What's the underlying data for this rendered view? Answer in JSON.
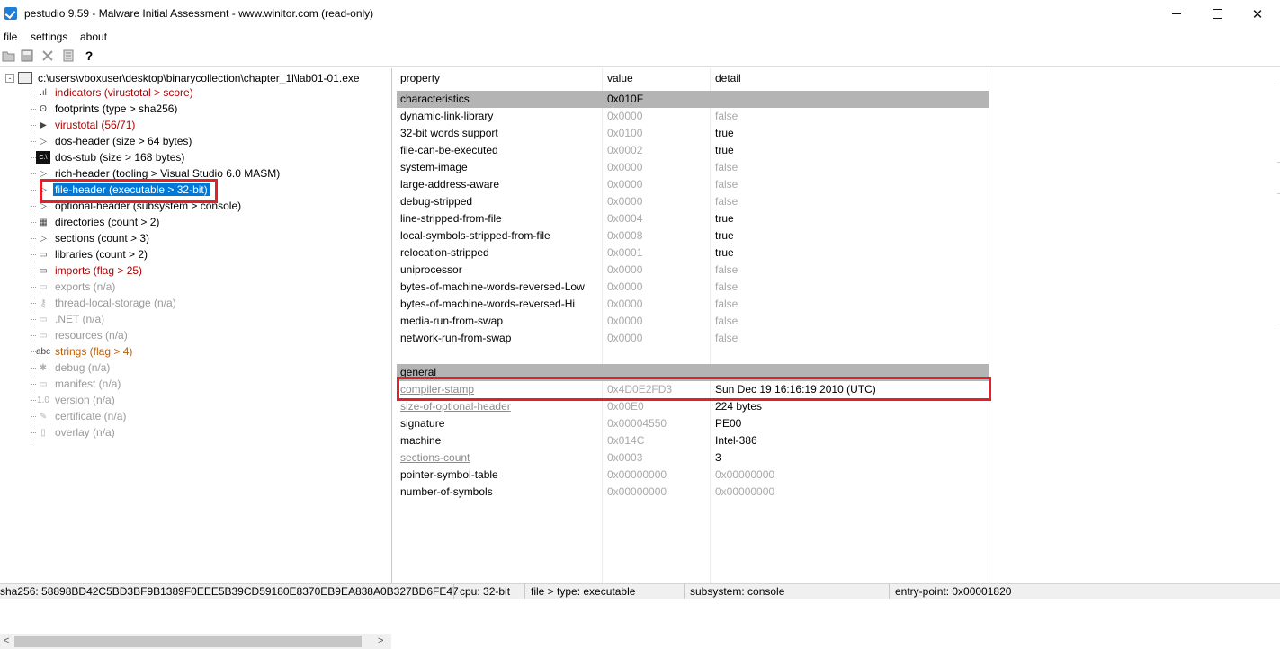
{
  "window": {
    "title": "pestudio 9.59 - Malware Initial Assessment - www.winitor.com (read-only)"
  },
  "menu": [
    "file",
    "settings",
    "about"
  ],
  "toolbar": {
    "icons": [
      "open-icon",
      "save-icon",
      "cancel-icon",
      "list-icon",
      "help-icon"
    ],
    "help_glyph": "?"
  },
  "tree": {
    "root": {
      "expander": "-",
      "label": "c:\\users\\vboxuser\\desktop\\binarycollection\\chapter_1l\\lab01-01.exe"
    },
    "items": [
      {
        "label": "indicators (virustotal > score)",
        "style": "red",
        "icon": ".ıl"
      },
      {
        "label": "footprints (type > sha256)",
        "style": "normal",
        "icon": "ʘ"
      },
      {
        "label": "virustotal (56/71)",
        "style": "red",
        "icon": "▶"
      },
      {
        "label": "dos-header (size > 64 bytes)",
        "style": "normal",
        "icon": "▷"
      },
      {
        "label": "dos-stub (size > 168 bytes)",
        "style": "normal",
        "icon": "C:\\"
      },
      {
        "label": "rich-header (tooling > Visual Studio 6.0 MASM)",
        "style": "normal",
        "icon": "▷"
      },
      {
        "label": "file-header (executable > 32-bit)",
        "style": "selected",
        "icon": "▷"
      },
      {
        "label": "optional-header (subsystem > console)",
        "style": "normal",
        "icon": "▷"
      },
      {
        "label": "directories (count > 2)",
        "style": "normal",
        "icon": "▦"
      },
      {
        "label": "sections (count > 3)",
        "style": "normal",
        "icon": "▷"
      },
      {
        "label": "libraries (count > 2)",
        "style": "normal",
        "icon": "▭"
      },
      {
        "label": "imports (flag > 25)",
        "style": "red",
        "icon": "▭"
      },
      {
        "label": "exports (n/a)",
        "style": "gray",
        "icon": "▭"
      },
      {
        "label": "thread-local-storage (n/a)",
        "style": "gray",
        "icon": "⚷"
      },
      {
        "label": ".NET (n/a)",
        "style": "gray",
        "icon": "▭"
      },
      {
        "label": "resources (n/a)",
        "style": "gray",
        "icon": "▭"
      },
      {
        "label": "strings (flag > 4)",
        "style": "orange",
        "icon": "abc"
      },
      {
        "label": "debug (n/a)",
        "style": "gray",
        "icon": "✱"
      },
      {
        "label": "manifest (n/a)",
        "style": "gray",
        "icon": "▭"
      },
      {
        "label": "version (n/a)",
        "style": "gray",
        "icon": "1.0"
      },
      {
        "label": "certificate (n/a)",
        "style": "gray",
        "icon": "✎"
      },
      {
        "label": "overlay (n/a)",
        "style": "gray",
        "icon": "▯"
      }
    ]
  },
  "table": {
    "columns": [
      "property",
      "value",
      "detail"
    ],
    "rows": [
      {
        "property": "characteristics",
        "value": "0x010F",
        "detail": "",
        "kind": "group"
      },
      {
        "property": "dynamic-link-library",
        "value": "0x0000",
        "detail": "false",
        "kind": "dim"
      },
      {
        "property": "32-bit words support",
        "value": "0x0100",
        "detail": "true",
        "kind": "on"
      },
      {
        "property": "file-can-be-executed",
        "value": "0x0002",
        "detail": "true",
        "kind": "on"
      },
      {
        "property": "system-image",
        "value": "0x0000",
        "detail": "false",
        "kind": "dim"
      },
      {
        "property": "large-address-aware",
        "value": "0x0000",
        "detail": "false",
        "kind": "dim"
      },
      {
        "property": "debug-stripped",
        "value": "0x0000",
        "detail": "false",
        "kind": "dim"
      },
      {
        "property": "line-stripped-from-file",
        "value": "0x0004",
        "detail": "true",
        "kind": "on"
      },
      {
        "property": "local-symbols-stripped-from-file",
        "value": "0x0008",
        "detail": "true",
        "kind": "on"
      },
      {
        "property": "relocation-stripped",
        "value": "0x0001",
        "detail": "true",
        "kind": "on"
      },
      {
        "property": "uniprocessor",
        "value": "0x0000",
        "detail": "false",
        "kind": "dim"
      },
      {
        "property": "bytes-of-machine-words-reversed-Low",
        "value": "0x0000",
        "detail": "false",
        "kind": "dim"
      },
      {
        "property": "bytes-of-machine-words-reversed-Hi",
        "value": "0x0000",
        "detail": "false",
        "kind": "dim"
      },
      {
        "property": "media-run-from-swap",
        "value": "0x0000",
        "detail": "false",
        "kind": "dim"
      },
      {
        "property": "network-run-from-swap",
        "value": "0x0000",
        "detail": "false",
        "kind": "dim"
      },
      {
        "property": "",
        "value": "",
        "detail": "",
        "kind": "blank"
      },
      {
        "property": "general",
        "value": "",
        "detail": "",
        "kind": "group"
      },
      {
        "property": "compiler-stamp",
        "value": "0x4D0E2FD3",
        "detail": "Sun Dec 19 16:16:19 2010 (UTC)",
        "kind": "link"
      },
      {
        "property": "size-of-optional-header",
        "value": "0x00E0",
        "detail": "224 bytes",
        "kind": "link"
      },
      {
        "property": "signature",
        "value": "0x00004550",
        "detail": "PE00",
        "kind": "on"
      },
      {
        "property": "machine",
        "value": "0x014C",
        "detail": "Intel-386",
        "kind": "on"
      },
      {
        "property": "sections-count",
        "value": "0x0003",
        "detail": "3",
        "kind": "link"
      },
      {
        "property": "pointer-symbol-table",
        "value": "0x00000000",
        "detail": "0x00000000",
        "kind": "on-dimdetail"
      },
      {
        "property": "number-of-symbols",
        "value": "0x00000000",
        "detail": "0x00000000",
        "kind": "on-dimdetail"
      }
    ]
  },
  "status": {
    "sha256": "sha256: 58898BD42C5BD3BF9B1389F0EEE5B39CD59180E8370EB9EA838A0B327BD6FE47",
    "cpu": "cpu: 32-bit",
    "filetype": "file > type: executable",
    "subsystem": "subsystem: console",
    "entry": "entry-point: 0x00001820"
  },
  "colors": {
    "selection": "#0078d7",
    "group_row": "#b4b4b4",
    "red_text": "#b00000",
    "orange_text": "#c25e00",
    "gray_text": "#9a9a9a",
    "callout": "#e0202a"
  }
}
